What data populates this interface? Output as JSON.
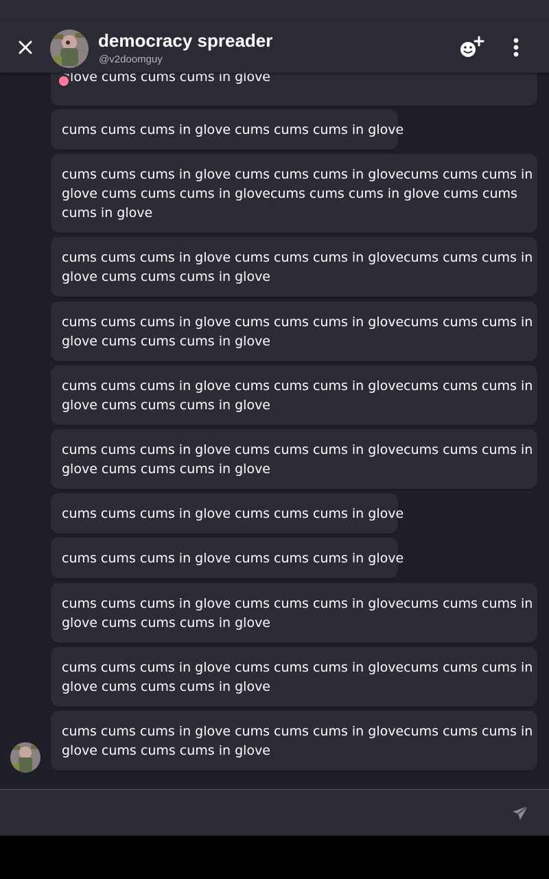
{
  "header": {
    "name": "democracy spreader",
    "handle": "@v2doomguy",
    "presence_color": "#ff7a9c"
  },
  "icons": {
    "close": "close-icon",
    "add_friend": "add-friend-icon",
    "more": "more-vertical-icon",
    "send": "send-icon"
  },
  "messages": [
    {
      "lines": [
        "glove cums cums cums in glove"
      ]
    },
    {
      "lines": [
        "cums cums cums in glove cums cums cums in glove"
      ]
    },
    {
      "lines": [
        "cums cums cums in glove cums cums cums in glovecums cums cums in",
        "glove cums cums cums in glovecums cums cums in glove cums cums",
        "cums in glove"
      ]
    },
    {
      "lines": [
        "cums cums cums in glove cums cums cums in glovecums cums cums in",
        "glove cums cums cums in glove"
      ]
    },
    {
      "lines": [
        "cums cums cums in glove cums cums cums in glovecums cums cums in",
        "glove cums cums cums in glove"
      ]
    },
    {
      "lines": [
        "cums cums cums in glove cums cums cums in glovecums cums cums in",
        "glove cums cums cums in glove"
      ]
    },
    {
      "lines": [
        "cums cums cums in glove cums cums cums in glovecums cums cums in",
        "glove cums cums cums in glove"
      ]
    },
    {
      "lines": [
        "cums cums cums in glove cums cums cums in glove"
      ]
    },
    {
      "lines": [
        "cums cums cums in glove cums cums cums in glove"
      ]
    },
    {
      "lines": [
        "cums cums cums in glove cums cums cums in glovecums cums cums in",
        "glove cums cums cums in glove"
      ]
    },
    {
      "lines": [
        "cums cums cums in glove cums cums cums in glovecums cums cums in",
        "glove cums cums cums in glove"
      ]
    },
    {
      "lines": [
        "cums cums cums in glove cums cums cums in glovecums cums cums in",
        "glove cums cums cums in glove"
      ]
    }
  ],
  "composer": {
    "placeholder": ""
  }
}
